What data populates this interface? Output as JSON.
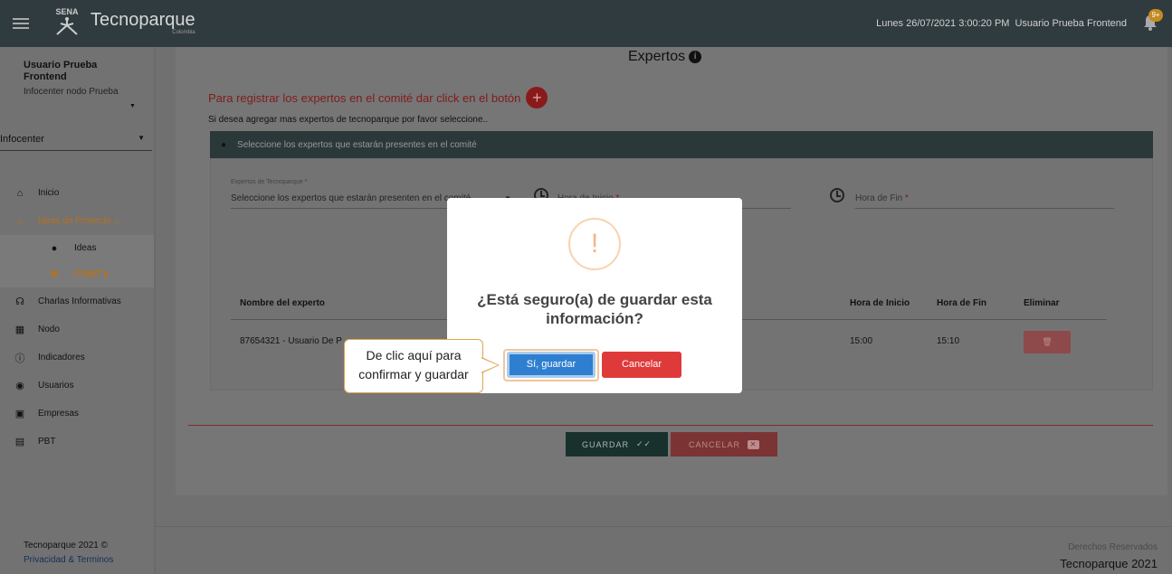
{
  "topbar": {
    "logo_text": "SENA",
    "brand": "Tecnoparque",
    "country": "Colombia",
    "datetime": "Lunes 26/07/2021 3:00:20 PM",
    "user": "Usuario Prueba Frontend",
    "notif_count": "9+"
  },
  "sidebar": {
    "user_name": "Usuario Prueba Frontend",
    "user_node": "Infocenter nodo Prueba",
    "role": "Infocenter",
    "items": [
      {
        "label": "Inicio",
        "icon": "home-icon"
      },
      {
        "label": "Ideas de Proyecto",
        "icon": "lightbulb-icon"
      },
      {
        "label": "Ideas",
        "icon": "bulb-small-icon"
      },
      {
        "label": "CSIBT's",
        "icon": "gavel-icon"
      },
      {
        "label": "Charlas Informativas",
        "icon": "presenter-icon"
      },
      {
        "label": "Nodo",
        "icon": "building-icon"
      },
      {
        "label": "Indicadores",
        "icon": "info-circle-icon"
      },
      {
        "label": "Usuarios",
        "icon": "users-icon"
      },
      {
        "label": "Empresas",
        "icon": "briefcase-icon"
      },
      {
        "label": "PBT",
        "icon": "document-icon"
      }
    ],
    "footer_copy": "Tecnoparque 2021 ©",
    "footer_privacy": "Privacidad",
    "footer_amp": "&",
    "footer_terms": "Terminos"
  },
  "main": {
    "section_title": "Expertos",
    "register_text": "Para registrar los expertos en el comité dar click en el botón",
    "hint_text": "Si desea agregar mas expertos de tecnoparque por favor seleccione..",
    "banner_text": "Seleccione los expertos que estarán presentes en el comité",
    "field_label": "Expertos de Tecnoparque",
    "field_value": "Seleccione los expertos que estarán presenten en el comité",
    "start_label": "Hora de Inicio",
    "end_label": "Hora de Fin",
    "required_mark": "*",
    "table": {
      "headers": [
        "Nombre del experto",
        "Hora de Inicio",
        "Hora de Fin",
        "Eliminar"
      ],
      "rows": [
        {
          "name": "87654321 - Usuario De P",
          "start": "15:00",
          "end": "15:10"
        }
      ]
    },
    "save_label": "GUARDAR",
    "cancel_label": "CANCELAR"
  },
  "modal": {
    "warn_symbol": "!",
    "title": "¿Está seguro(a) de guardar esta información?",
    "confirm_label": "Sí, guardar",
    "cancel_label": "Cancelar"
  },
  "callout": {
    "text_line1": "De clic aquí para",
    "text_line2": "confirmar y guardar"
  },
  "footer": {
    "rights": "Derechos Reservados",
    "brand_year": "Tecnoparque 2021"
  }
}
